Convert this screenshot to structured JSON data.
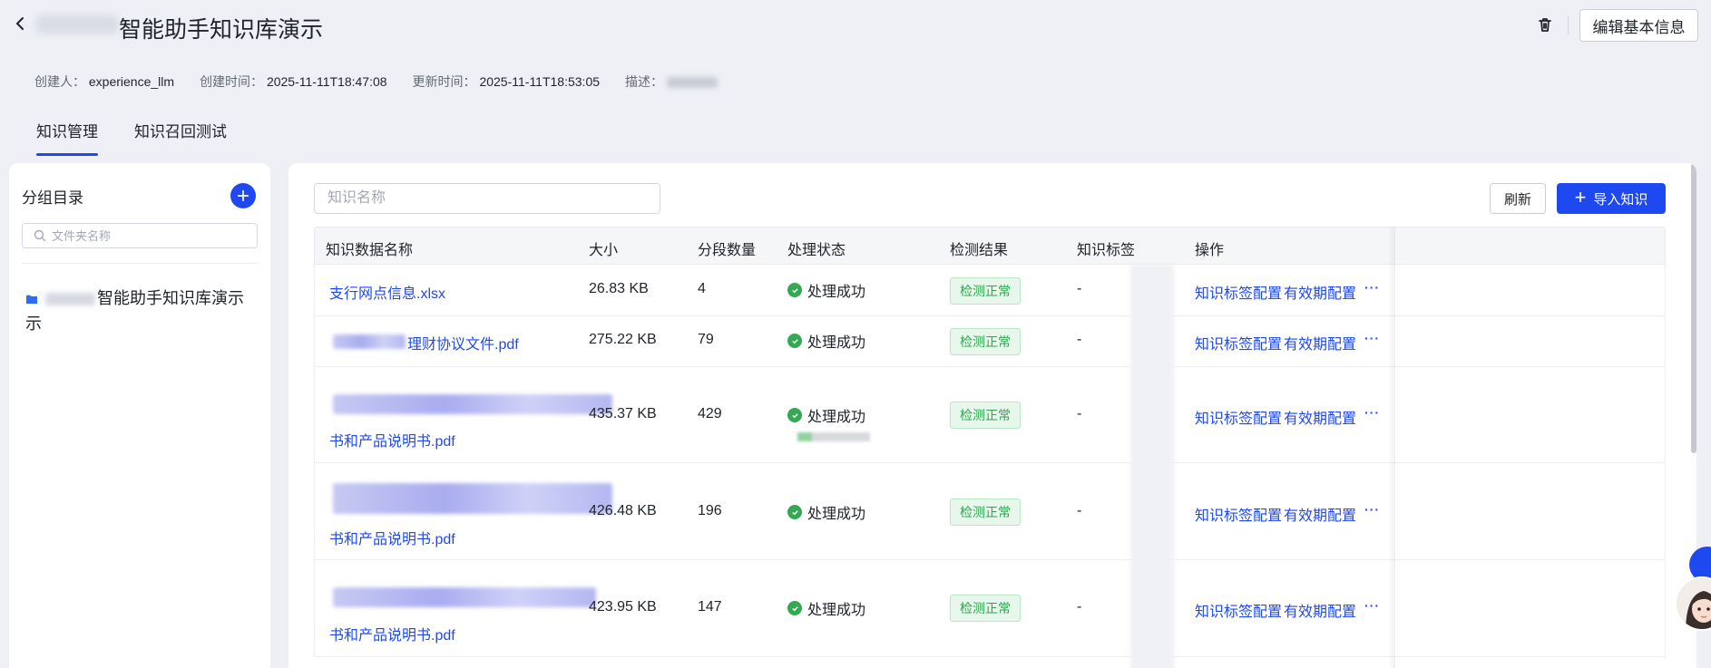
{
  "header": {
    "title": "智能助手知识库演示",
    "edit_label": "编辑基本信息"
  },
  "meta": {
    "creator_label": "创建人：",
    "creator": "experience_llm",
    "created_label": "创建时间：",
    "created": "2025-11-11T18:47:08",
    "updated_label": "更新时间：",
    "updated": "2025-11-11T18:53:05",
    "desc_label": "描述："
  },
  "tabs": [
    {
      "label": "知识管理",
      "active": true
    },
    {
      "label": "知识召回测试",
      "active": false
    }
  ],
  "sidebar": {
    "title": "分组目录",
    "search_placeholder": "文件夹名称",
    "folder_name": "智能助手知识库演示"
  },
  "main": {
    "search_placeholder": "知识名称",
    "refresh_label": "刷新",
    "import_label": "导入知识",
    "columns": [
      "知识数据名称",
      "大小",
      "分段数量",
      "处理状态",
      "检测结果",
      "知识标签",
      "操作"
    ],
    "rows": [
      {
        "name": "支行网点信息.xlsx",
        "name2": "",
        "size": "26.83 KB",
        "segments": "4",
        "status": "处理成功",
        "check": "检测正常",
        "tag": "-",
        "act1": "知识标签配置",
        "act2": "有效期配置"
      },
      {
        "name": "理财协议文件.pdf",
        "name2": "",
        "size": "275.22 KB",
        "segments": "79",
        "status": "处理成功",
        "check": "检测正常",
        "tag": "-",
        "act1": "知识标签配置",
        "act2": "有效期配置"
      },
      {
        "name": "",
        "name2": "书和产品说明书.pdf",
        "size": "435.37 KB",
        "segments": "429",
        "status": "处理成功",
        "check": "检测正常",
        "tag": "-",
        "act1": "知识标签配置",
        "act2": "有效期配置"
      },
      {
        "name": "",
        "name2": "书和产品说明书.pdf",
        "size": "426.48 KB",
        "segments": "196",
        "status": "处理成功",
        "check": "检测正常",
        "tag": "-",
        "act1": "知识标签配置",
        "act2": "有效期配置"
      },
      {
        "name": "",
        "name2": "书和产品说明书.pdf",
        "size": "423.95 KB",
        "segments": "147",
        "status": "处理成功",
        "check": "检测正常",
        "tag": "-",
        "act1": "知识标签配置",
        "act2": "有效期配置"
      }
    ],
    "more_label": "···"
  },
  "colors": {
    "accent": "#1f49f0",
    "success": "#34a853",
    "badge_bg": "#e8f7ec"
  }
}
